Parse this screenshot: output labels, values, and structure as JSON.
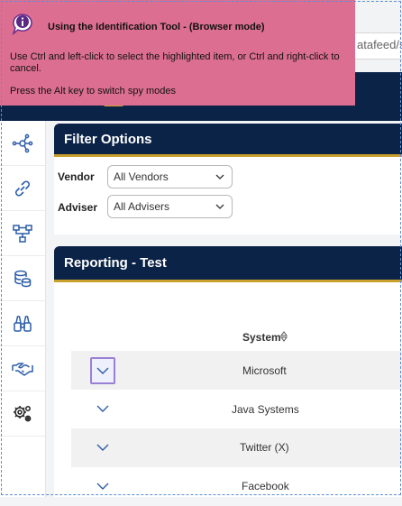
{
  "browser": {
    "url_fragment": "atafeed/s"
  },
  "tooltip": {
    "title": "Using the Identification Tool - (Browser mode)",
    "instruction": "Use Ctrl and left-click to select the highlighted item, or Ctrl and right-click to cancel.",
    "hint": "Press the Alt key to switch spy modes",
    "icon": "info-speech-bubble-icon"
  },
  "left_rail": {
    "items": [
      {
        "icon": "network-nodes-icon"
      },
      {
        "icon": "link-icon"
      },
      {
        "icon": "hierarchy-icon"
      },
      {
        "icon": "database-coins-icon"
      },
      {
        "icon": "binoculars-icon"
      },
      {
        "icon": "handshake-icon"
      },
      {
        "icon": "settings-gears-icon"
      }
    ]
  },
  "filter_options": {
    "title": "Filter Options",
    "vendor_label": "Vendor",
    "vendor_value": "All Vendors",
    "adviser_label": "Adviser",
    "adviser_value": "All Advisers"
  },
  "reporting": {
    "title": "Reporting - Test",
    "column_system": "System",
    "rows": [
      {
        "system": "Microsoft"
      },
      {
        "system": "Java Systems"
      },
      {
        "system": "Twitter (X)"
      },
      {
        "system": "Facebook"
      }
    ]
  },
  "colors": {
    "navy": "#0b2347",
    "gold": "#c9a02b",
    "tooltip_pink": "#dc6f91",
    "highlight_purple": "#9a7fd6",
    "icon_blue": "#2b5da8"
  }
}
